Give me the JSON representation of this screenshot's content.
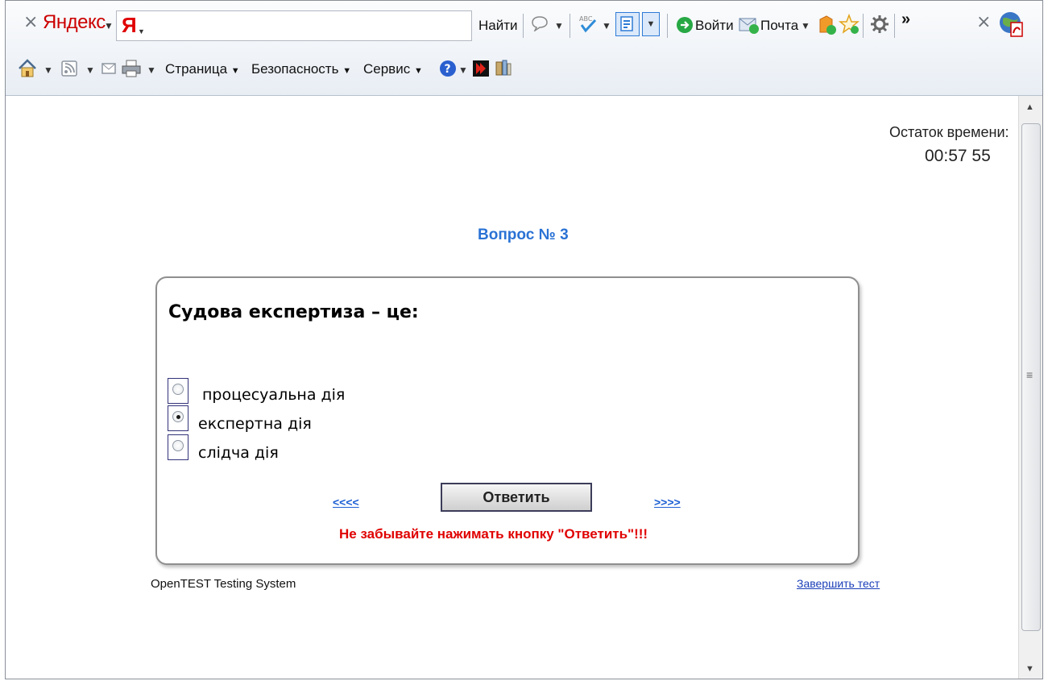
{
  "yandex_bar": {
    "brand": "Яндекс",
    "search_logo": "Я",
    "search_value": "",
    "find_label": "Найти",
    "login_label": "Войти",
    "mail_label": "Почта",
    "more_glyph": "»"
  },
  "command_bar": {
    "page_menu": "Страница",
    "security_menu": "Безопасность",
    "service_menu": "Сервис"
  },
  "timer": {
    "label": "Остаток времени:",
    "value": "00:57 55"
  },
  "question": {
    "number_label": "Вопрос № 3",
    "text": "Судова експертиза – це:",
    "options": [
      {
        "label": "процесуальна дія",
        "selected": false
      },
      {
        "label": "експертна дія",
        "selected": true
      },
      {
        "label": "слідча дія",
        "selected": false
      }
    ],
    "prev_label": "<<<<",
    "next_label": ">>>>",
    "answer_label": "Ответить",
    "reminder": "Не забывайте нажимать кнопку \"Ответить\"!!!"
  },
  "footer": {
    "brand": "OpenTEST Testing System",
    "finish_label": "Завершить тест"
  },
  "colors": {
    "accent_blue": "#2a72d5",
    "warning_red": "#e00000",
    "yandex_red": "#cc0000"
  },
  "icons": [
    "home-icon",
    "rss-icon",
    "mail-icon",
    "print-icon",
    "help-icon",
    "kaspersky-icon",
    "research-icon",
    "settings-icon",
    "speech-bubble-icon",
    "spellcheck-icon",
    "translate-icon",
    "login-icon",
    "mail-icon",
    "favorites-icon",
    "pdf-icon"
  ]
}
